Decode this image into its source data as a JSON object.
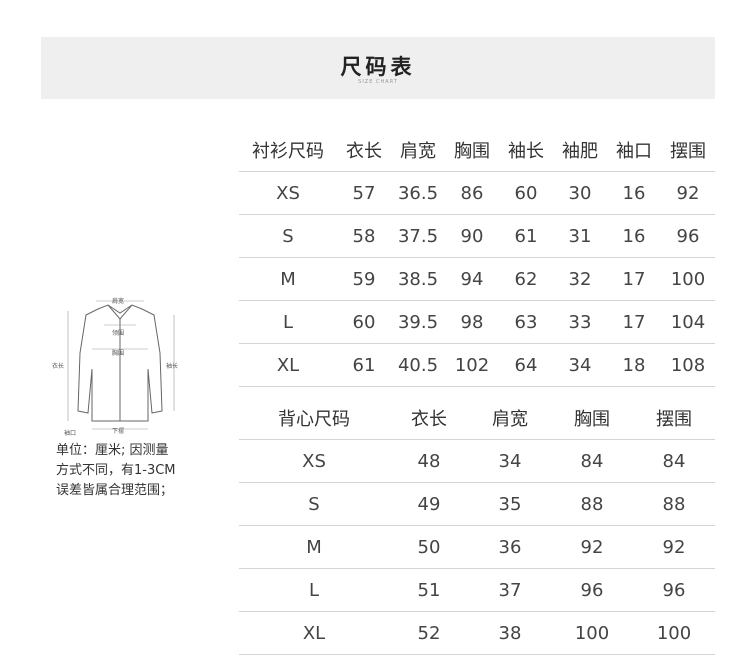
{
  "banner": {
    "title": "尺码表",
    "subtitle": "SIZE CHART"
  },
  "shirt": {
    "headers": [
      "衬衫尺码",
      "衣长",
      "肩宽",
      "胸围",
      "袖长",
      "袖肥",
      "袖口",
      "摆围"
    ],
    "rows": [
      [
        "XS",
        "57",
        "36.5",
        "86",
        "60",
        "30",
        "16",
        "92"
      ],
      [
        "S",
        "58",
        "37.5",
        "90",
        "61",
        "31",
        "16",
        "96"
      ],
      [
        "M",
        "59",
        "38.5",
        "94",
        "62",
        "32",
        "17",
        "100"
      ],
      [
        "L",
        "60",
        "39.5",
        "98",
        "63",
        "33",
        "17",
        "104"
      ],
      [
        "XL",
        "61",
        "40.5",
        "102",
        "64",
        "34",
        "18",
        "108"
      ]
    ]
  },
  "vest": {
    "headers": [
      "背心尺码",
      "衣长",
      "肩宽",
      "胸围",
      "摆围"
    ],
    "rows": [
      [
        "XS",
        "48",
        "34",
        "84",
        "84"
      ],
      [
        "S",
        "49",
        "35",
        "88",
        "88"
      ],
      [
        "M",
        "50",
        "36",
        "92",
        "92"
      ],
      [
        "L",
        "51",
        "37",
        "96",
        "96"
      ],
      [
        "XL",
        "52",
        "38",
        "100",
        "100"
      ]
    ]
  },
  "diagram": {
    "labels": {
      "shoulder": "肩宽",
      "collar": "领围",
      "chest": "胸围",
      "length": "衣长",
      "sleeve": "袖长",
      "hem": "下摆",
      "cuff": "袖口"
    }
  },
  "note": {
    "lines": [
      "单位：厘米; 因测量",
      "方式不同，有1-3CM",
      "误差皆属合理范围；"
    ]
  }
}
